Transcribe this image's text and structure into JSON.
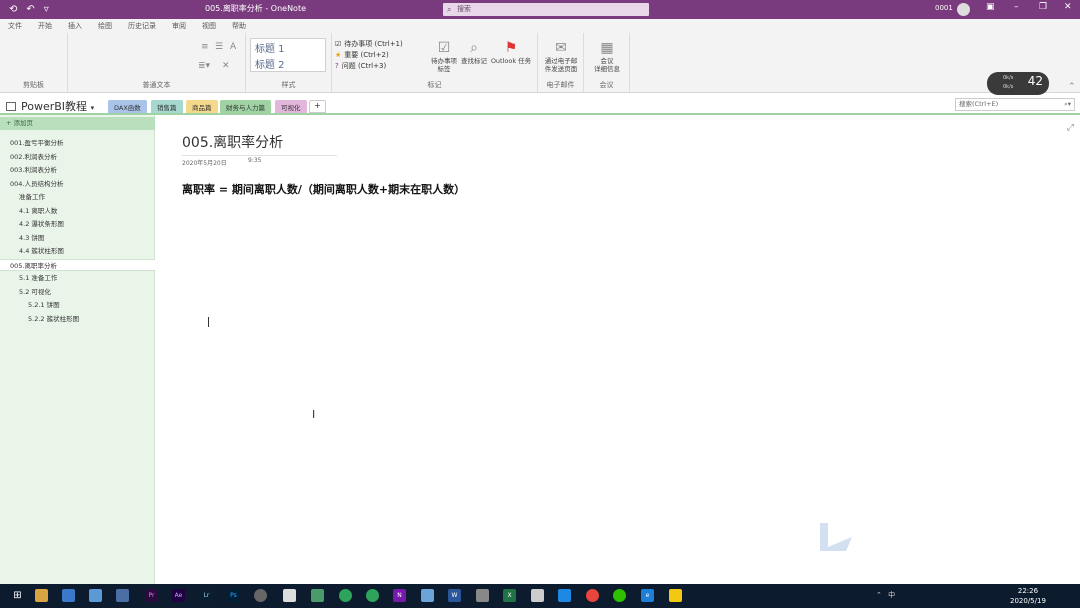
{
  "window": {
    "title": "005.离职率分析 - OneNote",
    "search_placeholder": "搜索",
    "user": "0001"
  },
  "ribbon_tabs": [
    "文件",
    "开始",
    "插入",
    "绘图",
    "历史记录",
    "审阅",
    "视图",
    "帮助"
  ],
  "ribbon": {
    "groups": {
      "clipboard": "剪贴板",
      "basic_text": "普通文本",
      "styles": "样式",
      "tags": "标记",
      "email": "电子邮件",
      "meeting": "会议"
    },
    "styles": [
      "标题 1",
      "标题 2"
    ],
    "tags": [
      "待办事项 (Ctrl+1)",
      "重要 (Ctrl+2)",
      "问题 (Ctrl+3)"
    ],
    "buttons": {
      "todo_tag": "待办事项\n标签",
      "find_tags": "查找标记",
      "outlook_tasks": "Outlook 任务",
      "email_page": "通过电子邮\n件发送页面",
      "meeting_details": "会议\n详细信息"
    }
  },
  "timer": {
    "value": "42",
    "line1": "0k/s",
    "line2": "0k/s"
  },
  "notebook": {
    "name": "PowerBI教程",
    "sections": [
      {
        "label": "DAX函数",
        "color": "#a9c4e8"
      },
      {
        "label": "销售篇",
        "color": "#a6d8d0"
      },
      {
        "label": "商品篇",
        "color": "#f4d98c"
      },
      {
        "label": "财务与人力篇",
        "color": "#9fd3a4"
      },
      {
        "label": "可视化",
        "color": "#e3b6dc"
      }
    ],
    "add_section": "+",
    "search_placeholder": "搜索(Ctrl+E)"
  },
  "sidebar": {
    "add_page": "添加页",
    "pages": [
      {
        "label": "001.盈亏平衡分析",
        "level": 0
      },
      {
        "label": "002.利润表分析",
        "level": 0
      },
      {
        "label": "003.利润表分析",
        "level": 0
      },
      {
        "label": "004.人员结构分析",
        "level": 0
      },
      {
        "label": "准备工作",
        "level": 1
      },
      {
        "label": "4.1 离职人数",
        "level": 1
      },
      {
        "label": "4.2 瀑状条形图",
        "level": 1
      },
      {
        "label": "4.3 饼图",
        "level": 1
      },
      {
        "label": "4.4 簇状柱形图",
        "level": 1
      },
      {
        "label": "005.离职率分析",
        "level": 0,
        "selected": true
      },
      {
        "label": "5.1 准备工作",
        "level": 1
      },
      {
        "label": "5.2 可视化",
        "level": 1
      },
      {
        "label": "5.2.1 饼图",
        "level": 2
      },
      {
        "label": "5.2.2 簇状柱形图",
        "level": 2
      }
    ]
  },
  "page": {
    "title": "005.离职率分析",
    "date": "2020年5月20日",
    "time": "9:35",
    "formula": "离职率 = 期间离职人数/（期间离职人数+期末在职人数）"
  },
  "taskbar": {
    "tray": "⌃ 中",
    "time": "22:26",
    "date": "2020/5/19"
  }
}
